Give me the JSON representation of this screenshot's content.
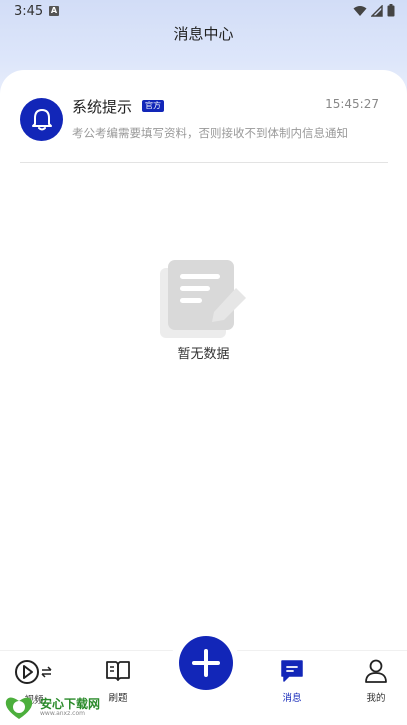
{
  "status_bar": {
    "time": "3:45",
    "notification_letter": "A"
  },
  "header": {
    "title": "消息中心"
  },
  "messages": [
    {
      "title": "系统提示",
      "badge": "官方",
      "time": "15:45:27",
      "preview": "考公考编需要填写资料，否则接收不到体制内信息通知",
      "icon": "bell-icon"
    }
  ],
  "empty_state": {
    "text": "暂无数据",
    "icon": "document-edit-icon"
  },
  "bottom_nav": {
    "items": [
      {
        "label": "视频",
        "icon": "play-circle-icon"
      },
      {
        "label": "刷题",
        "icon": "open-book-icon"
      },
      {
        "label": "",
        "icon": "plus-icon"
      },
      {
        "label": "消息",
        "icon": "chat-bubble-icon",
        "active": true
      },
      {
        "label": "我的",
        "icon": "user-icon"
      }
    ]
  },
  "watermark": {
    "text": "安心下载网",
    "sub": "www.anxz.com"
  },
  "colors": {
    "accent": "#1226b8",
    "muted_text": "#999999"
  }
}
